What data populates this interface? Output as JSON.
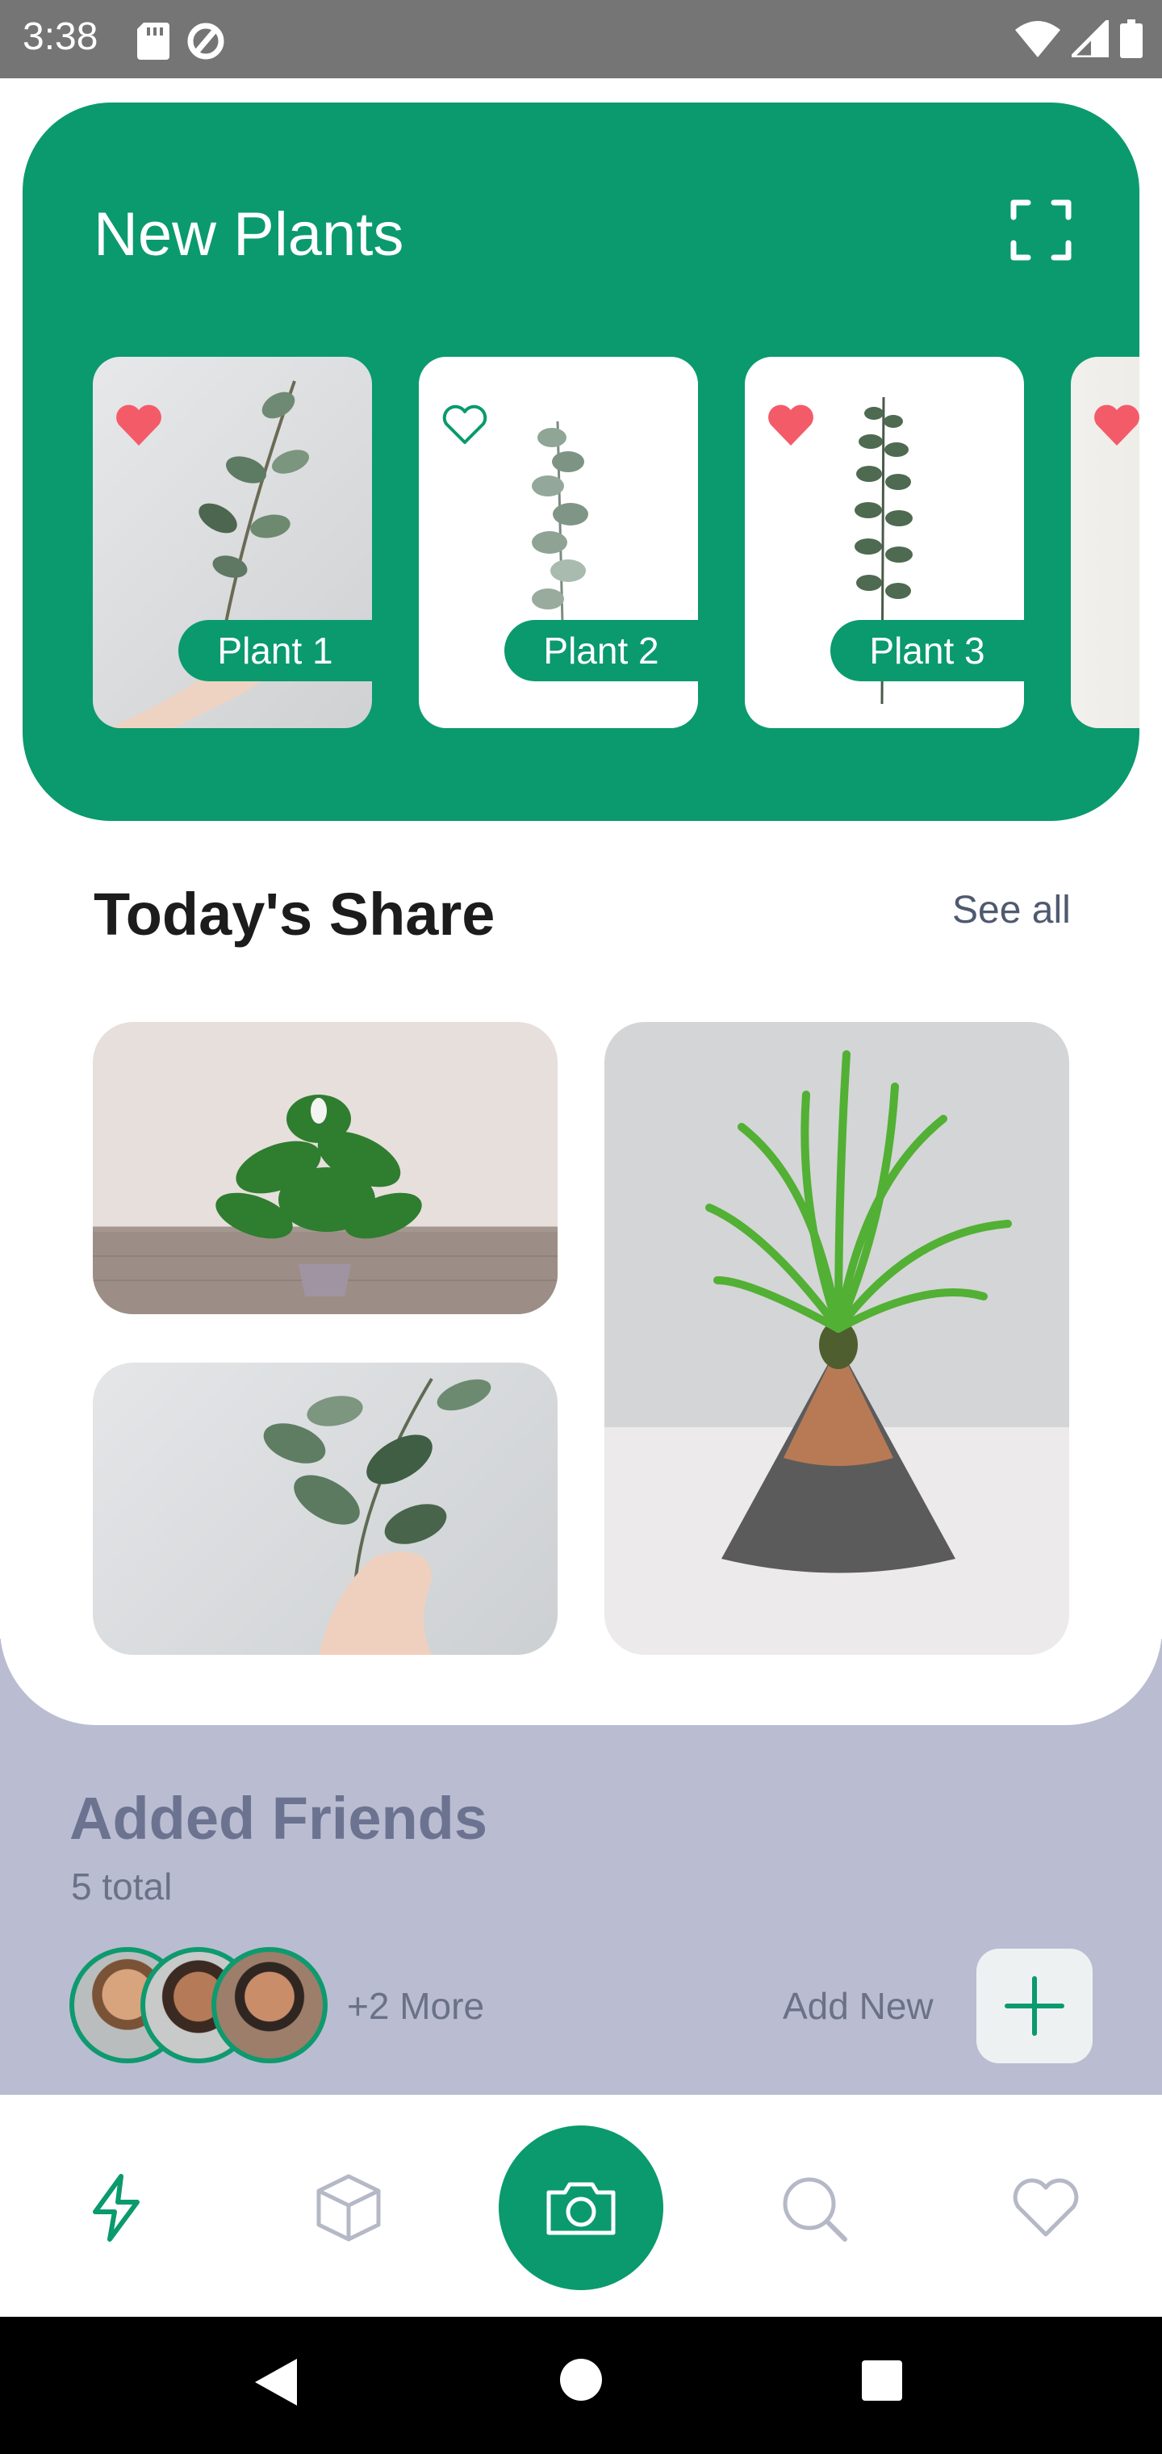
{
  "status_bar": {
    "time": "3:38"
  },
  "new_plants": {
    "title": "New Plants",
    "items": [
      {
        "label": "Plant 1",
        "favorited": true
      },
      {
        "label": "Plant 2",
        "favorited": false
      },
      {
        "label": "Plant 3",
        "favorited": true
      },
      {
        "label": "",
        "favorited": true
      }
    ]
  },
  "todays_share": {
    "title": "Today's Share",
    "see_all": "See all"
  },
  "friends": {
    "title": "Added Friends",
    "count": "5 total",
    "more": "+2 More",
    "add_new": "Add New"
  },
  "nav": {
    "items": [
      "activity-icon",
      "box-icon",
      "camera-icon",
      "search-icon",
      "heart-icon"
    ],
    "active": "activity-icon"
  },
  "colors": {
    "accent": "#0a9a6d",
    "panel": "#babdd1",
    "heart": "#f45b69"
  }
}
